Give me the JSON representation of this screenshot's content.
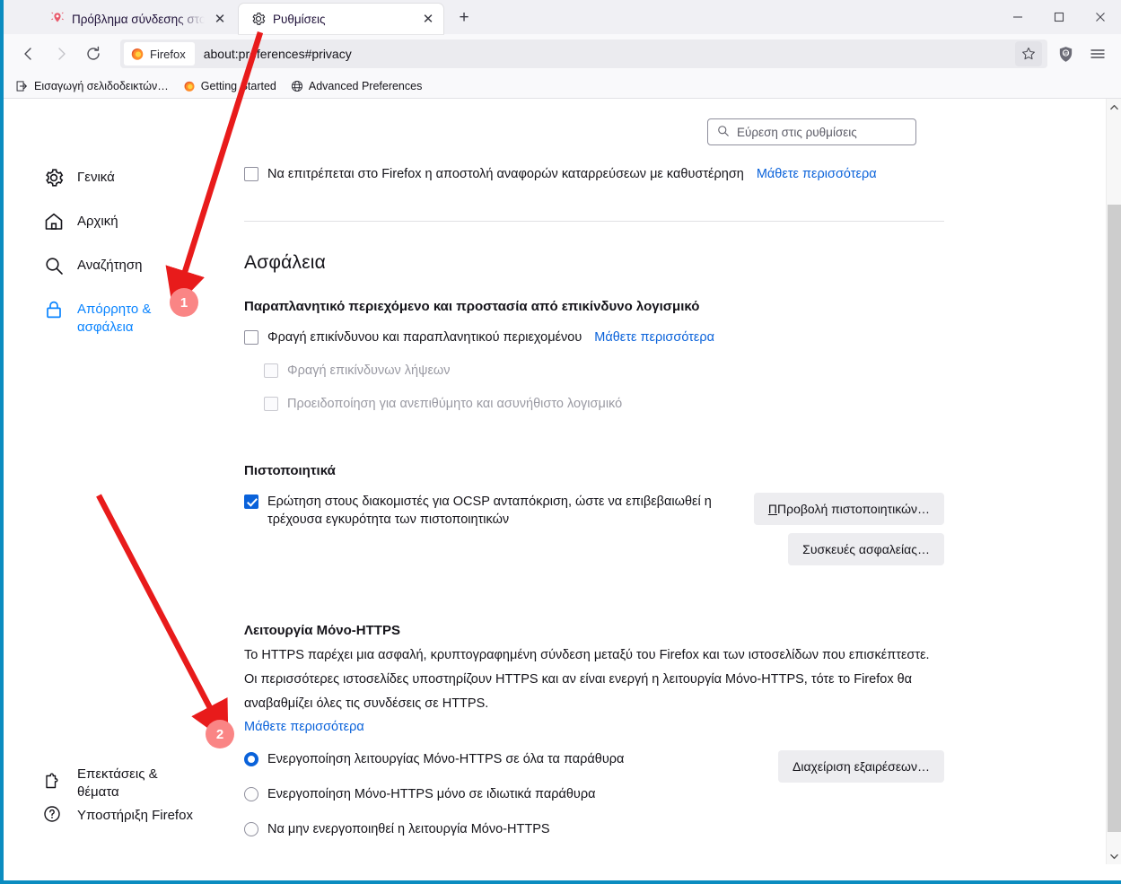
{
  "window": {
    "minimize_label": "─",
    "maximize_label": "□",
    "close_label": "✕"
  },
  "tabs": [
    {
      "title": "Πρόβλημα σύνδεσης στο bourd",
      "icon": "broken-connection-icon",
      "active": false
    },
    {
      "title": "Ρυθμίσεις",
      "icon": "gear-icon",
      "active": true
    }
  ],
  "newtab_label": "+",
  "toolbar": {
    "back_label": "←",
    "forward_label": "→",
    "reload_label": "⟳",
    "identity_label": "Firefox",
    "url": "about:preferences#privacy",
    "star_label": "☆",
    "shield_label": "uBlock Origin",
    "menu_label": "≡"
  },
  "bookmarks": [
    {
      "label": "Εισαγωγή σελιδοδεικτών…",
      "icon": "import-icon"
    },
    {
      "label": "Getting Started",
      "icon": "firefox-icon"
    },
    {
      "label": "Advanced Preferences",
      "icon": "globe-icon"
    }
  ],
  "sidebar": {
    "items": [
      {
        "label": "Γενικά",
        "icon": "gear-icon",
        "selected": false
      },
      {
        "label": "Αρχική",
        "icon": "home-icon",
        "selected": false
      },
      {
        "label": "Αναζήτηση",
        "icon": "search-icon",
        "selected": false
      },
      {
        "label": "Απόρρητο & ασφάλεια",
        "icon": "lock-icon",
        "selected": true
      }
    ],
    "bottom_items": [
      {
        "label": "Επεκτάσεις & θέματα",
        "icon": "puzzle-icon"
      },
      {
        "label": "Υποστήριξη Firefox",
        "icon": "question-circle-icon"
      }
    ]
  },
  "search": {
    "placeholder": "Εύρεση στις ρυθμίσεις",
    "value": ""
  },
  "main": {
    "crash_reports": {
      "label": "Να επιτρέπεται στο Firefox η αποστολή αναφορών καταρρεύσεων με καθυστέρηση",
      "learn_more": "Μάθετε περισσότερα",
      "checked": false
    },
    "security_heading": "Ασφάλεια",
    "deceptive": {
      "heading": "Παραπλανητικό περιεχόμενο και προστασία από επικίνδυνο λογισμικό",
      "main_label": "Φραγή επικίνδυνου και παραπλανητικού περιεχομένου",
      "main_learn_more": "Μάθετε περισσότερα",
      "main_checked": false,
      "sub1_label": "Φραγή επικίνδυνων λήψεων",
      "sub1_checked": false,
      "sub2_label": "Προειδοποίηση για ανεπιθύμητο και ασυνήθιστο λογισμικό",
      "sub2_checked": false
    },
    "certificates": {
      "heading": "Πιστοποιητικά",
      "ocsp_label": "Ερώτηση στους διακομιστές για OCSP ανταπόκριση, ώστε να επιβεβαιωθεί η τρέχουσα εγκυρότητα των πιστοποιητικών",
      "ocsp_checked": true,
      "view_certs_button": "Προβολή πιστοποιητικών…",
      "security_devices_button": "Συσκευές ασφαλείας…"
    },
    "https_only": {
      "heading": "Λειτουργία Μόνο-HTTPS",
      "description": "Το HTTPS παρέχει μια ασφαλή, κρυπτογραφημένη σύνδεση μεταξύ του Firefox και των ιστοσελίδων που επισκέπτεστε. Οι περισσότερες ιστοσελίδες υποστηρίζουν HTTPS και αν είναι ενεργή η λειτουργία Μόνο-HTTPS, τότε το Firefox θα αναβαθμίζει όλες τις συνδέσεις σε HTTPS.",
      "learn_more": "Μάθετε περισσότερα",
      "options": [
        {
          "label": "Ενεργοποίηση λειτουργίας Μόνο-HTTPS σε όλα τα παράθυρα",
          "selected": true
        },
        {
          "label": "Ενεργοποίηση Μόνο-HTTPS μόνο σε ιδιωτικά παράθυρα",
          "selected": false
        },
        {
          "label": "Να μην ενεργοποιηθεί η λειτουργία Μόνο-HTTPS",
          "selected": false
        }
      ],
      "manage_exceptions_button": "Διαχείριση εξαιρέσεων…"
    }
  },
  "annotations": {
    "badge_color": "#fa8585",
    "arrow_color": "#e81b1b",
    "steps": [
      {
        "number": "1"
      },
      {
        "number": "2"
      }
    ]
  }
}
